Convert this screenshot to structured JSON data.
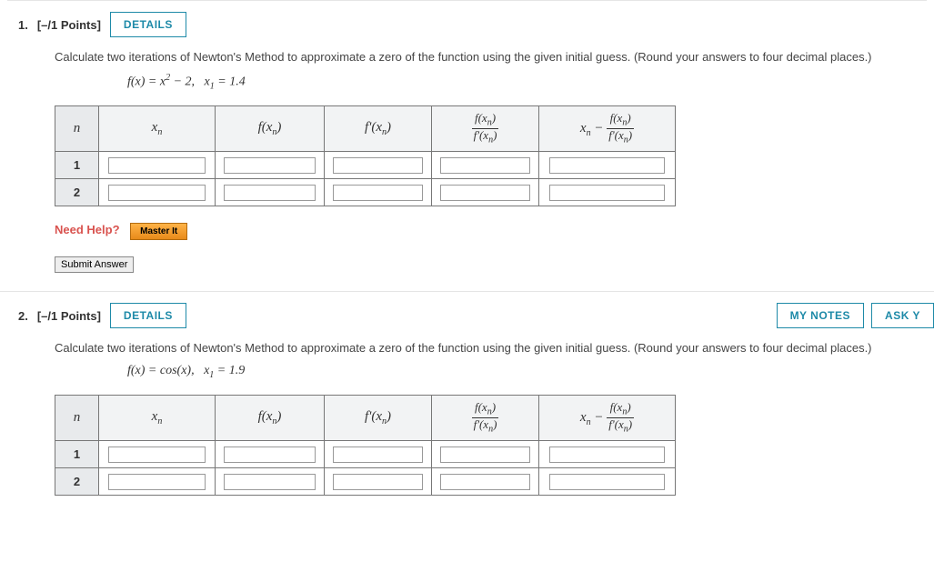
{
  "labels": {
    "details": "DETAILS",
    "myNotes": "MY NOTES",
    "askTeacher": "ASK Y",
    "needHelp": "Need Help?",
    "masterIt": "Master It",
    "submit": "Submit Answer"
  },
  "cols": {
    "n": "n",
    "xn_html": "x<span class='sub'>n</span>",
    "fxn_html": "f(x<span class='sub'>n</span>)",
    "fpxn_html": "f'(x<span class='sub'>n</span>)",
    "ratio_top": "f(x<span class='sub'>n</span>)",
    "ratio_bot": "f'(x<span class='sub'>n</span>)",
    "update_pre": "x<span class='sub'>n</span>  −  "
  },
  "q1": {
    "num": "1.",
    "pts": "[–/1 Points]",
    "prompt": "Calculate two iterations of Newton's Method to approximate a zero of the function using the given initial guess. (Round your answers to four decimal places.)",
    "func_html": "f(x) = x<span class='sup'>2</span> − 2,&nbsp;&nbsp;&nbsp;x<span class='sub'>1</span> = 1.4",
    "rows": [
      "1",
      "2"
    ]
  },
  "q2": {
    "num": "2.",
    "pts": "[–/1 Points]",
    "prompt": "Calculate two iterations of Newton's Method to approximate a zero of the function using the given initial guess. (Round your answers to four decimal places.)",
    "func_html": "f(x) = cos(x),&nbsp;&nbsp;&nbsp;x<span class='sub'>1</span> = 1.9",
    "rows": [
      "1",
      "2"
    ]
  }
}
